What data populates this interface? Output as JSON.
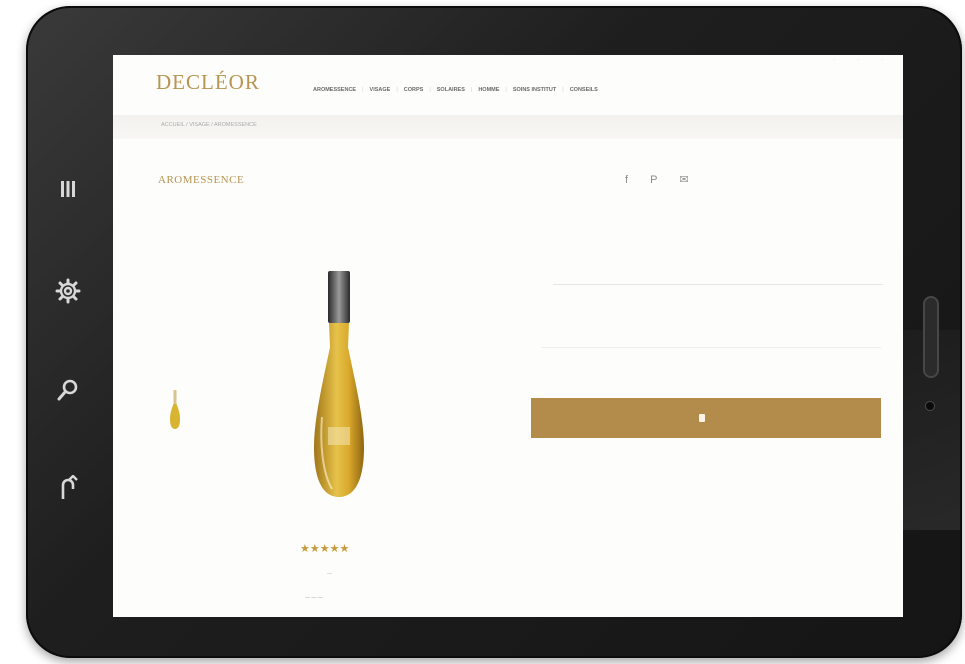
{
  "device": {
    "side_icons": [
      "menu-icon",
      "gear-icon",
      "search-icon",
      "share-back-icon"
    ]
  },
  "header": {
    "brand": "DECLÉOR",
    "topbar_links": [
      "·",
      "·",
      "·"
    ],
    "nav_items": [
      "AROMESSENCE",
      "VISAGE",
      "CORPS",
      "SOLAIRES",
      "HOMME",
      "SOINS INSTITUT",
      "CONSEILS"
    ]
  },
  "breadcrumb": "ACCUEIL / VISAGE / AROMESSENCE",
  "product": {
    "title": "AROMESSENCE",
    "subtitle": "",
    "rating_stars": 4.5,
    "rating_glyphs": "★★★★★"
  },
  "share": {
    "icons": [
      "facebook-icon",
      "pinterest-icon",
      "email-icon"
    ],
    "facebook": "f",
    "pinterest": "P",
    "email": "✉"
  },
  "description": "",
  "section_label": "",
  "description2": "",
  "buy_button": {
    "label": ""
  },
  "colors": {
    "gold": "#b79552",
    "button": "#b38b4a",
    "frame": "#1e1e1e"
  }
}
